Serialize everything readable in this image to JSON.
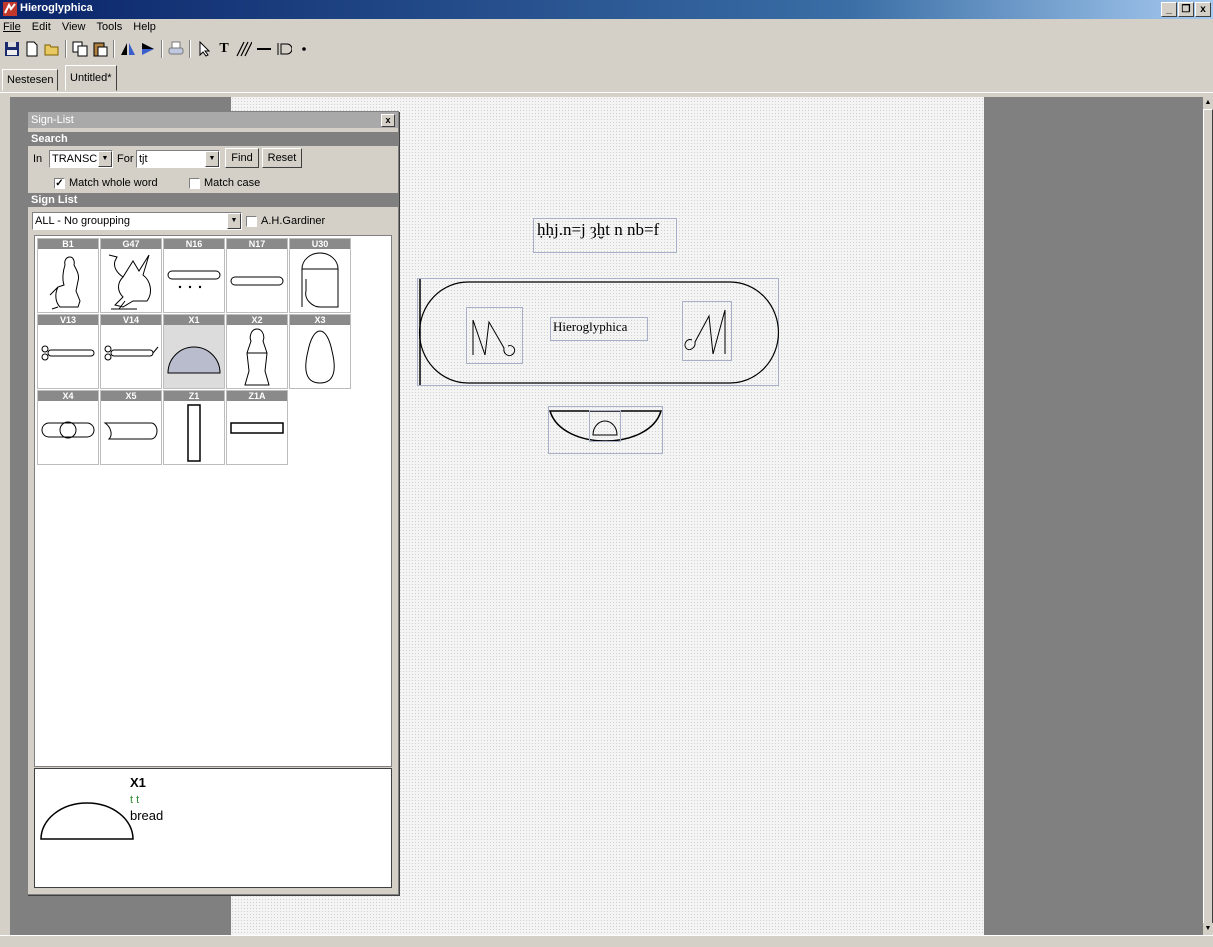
{
  "window": {
    "title": "Hieroglyphica",
    "buttons": [
      "_",
      "🗗",
      "x"
    ]
  },
  "menu": [
    "File",
    "Edit",
    "View",
    "Tools",
    "Help"
  ],
  "toolbar": {
    "icons": [
      "save-icon",
      "new-icon",
      "open-icon",
      "copy-icon",
      "paste-icon",
      "flip-left-icon",
      "flip-right-icon",
      "print-icon",
      "pointer-icon",
      "text-tool-icon",
      "hatch-tool-icon",
      "line-tool-icon",
      "cartouche-tool-icon",
      "dot-tool-icon"
    ],
    "text_tool_glyph": "T"
  },
  "tabs": [
    {
      "label": "Nestesen",
      "active": false
    },
    {
      "label": "Untitled*",
      "active": true
    }
  ],
  "signlist": {
    "title": "Sign-List",
    "close": "x",
    "search_section": "Search",
    "in_label": "In",
    "in_value": "TRANSCR",
    "for_label": "For",
    "for_value": "tjt",
    "find_button": "Find",
    "reset_button": "Reset",
    "match_whole_word": {
      "label": "Match whole word",
      "checked": true
    },
    "match_case": {
      "label": "Match case",
      "checked": false
    },
    "list_section": "Sign List",
    "grouping_value": "ALL - No groupping",
    "gardiner": {
      "label": "A.H.Gardiner",
      "checked": false
    },
    "signs": [
      {
        "code": "B1",
        "selected": false
      },
      {
        "code": "G47",
        "selected": false
      },
      {
        "code": "N16",
        "selected": false
      },
      {
        "code": "N17",
        "selected": false
      },
      {
        "code": "U30",
        "selected": false
      },
      {
        "code": "V13",
        "selected": false
      },
      {
        "code": "V14",
        "selected": false
      },
      {
        "code": "X1",
        "selected": true
      },
      {
        "code": "X2",
        "selected": false
      },
      {
        "code": "X3",
        "selected": false
      },
      {
        "code": "X4",
        "selected": false
      },
      {
        "code": "X5",
        "selected": false
      },
      {
        "code": "Z1",
        "selected": false
      },
      {
        "code": "Z1A",
        "selected": false
      }
    ],
    "detail": {
      "code": "X1",
      "transliteration": "t t",
      "meaning": "bread"
    }
  },
  "canvas": {
    "transliteration_text": "ḥḥj.n=j ȝḫt n nb=f",
    "cartouche_label": "Hieroglyphica"
  }
}
